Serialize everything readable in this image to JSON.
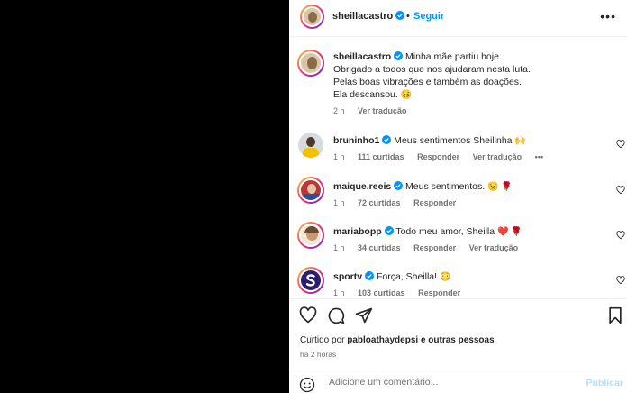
{
  "post": {
    "author": "sheillacastro",
    "dot": "•",
    "follow_label": "Seguir",
    "more": "•••"
  },
  "caption": {
    "username": "sheillacastro",
    "line1": "Minha mãe partiu hoje.",
    "line2": "Obrigado a todos que nos ajudaram nesta luta.",
    "line3": "Pelas boas vibrações e também as doações.",
    "line4": "Ela descansou.",
    "emoji": "😣",
    "time": "2 h",
    "translate": "Ver tradução"
  },
  "comments": [
    {
      "username": "bruninho1",
      "text": "Meus sentimentos Sheilinha",
      "emoji": "🙌",
      "time": "1 h",
      "likes": "111 curtidas",
      "reply": "Responder",
      "translate": "Ver tradução",
      "more": "•••"
    },
    {
      "username": "maique.reeis",
      "text": "Meus sentimentos.",
      "emoji": "😣 🌹",
      "time": "1 h",
      "likes": "72 curtidas",
      "reply": "Responder"
    },
    {
      "username": "mariabopp",
      "text": "Todo meu amor, Sheilla",
      "emoji": "❤️ 🌹",
      "time": "1 h",
      "likes": "34 curtidas",
      "reply": "Responder",
      "translate": "Ver tradução"
    },
    {
      "username": "sportv",
      "text": "Força, Sheilla!",
      "emoji": "😳",
      "time": "1 h",
      "likes": "103 curtidas",
      "reply": "Responder"
    }
  ],
  "liked_by": {
    "prefix": "Curtido por",
    "user": "pabloathaydepsi",
    "suffix": "e outras pessoas"
  },
  "post_time": "há 2 horas",
  "add_comment": {
    "placeholder": "Adicione um comentário...",
    "publish": "Publicar"
  },
  "icons": [
    "heart-icon",
    "comment-icon",
    "share-icon",
    "bookmark-icon",
    "emoji-icon",
    "verified-icon",
    "more-icon"
  ],
  "colors": {
    "verified": "#0095f6",
    "link": "#0095f6",
    "muted": "#737373",
    "text": "#262626"
  }
}
